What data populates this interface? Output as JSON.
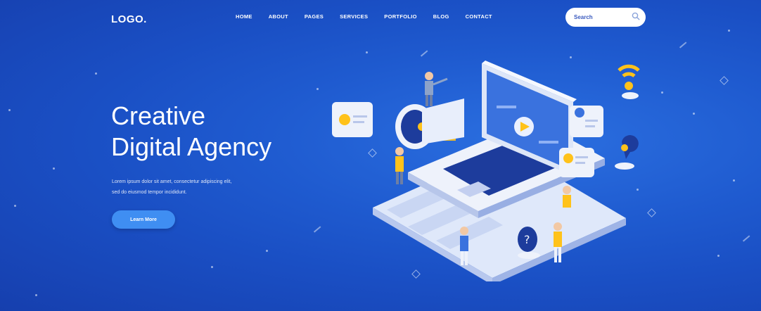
{
  "header": {
    "logo": "LOGO.",
    "nav": [
      "HOME",
      "ABOUT",
      "PAGES",
      "SERVICES",
      "PORTFOLIO",
      "BLOG",
      "CONTACT"
    ],
    "search_placeholder": "Search"
  },
  "hero": {
    "title_line1": "Creative",
    "title_line2": "Digital Agency",
    "subtext_line1": "Lorem ipsum dolor sit amet, consectetur adipiscing elit,",
    "subtext_line2": "sed do eiusmod tempor incididunt.",
    "cta_label": "Learn More"
  },
  "colors": {
    "background": "#1f5bd0",
    "accent": "#3f8ef2",
    "highlight": "#ffc21a"
  },
  "icons": [
    "search-icon",
    "megaphone-icon",
    "laptop-icon",
    "wifi-icon",
    "location-pin-icon",
    "chat-bubble-icon",
    "play-icon"
  ]
}
